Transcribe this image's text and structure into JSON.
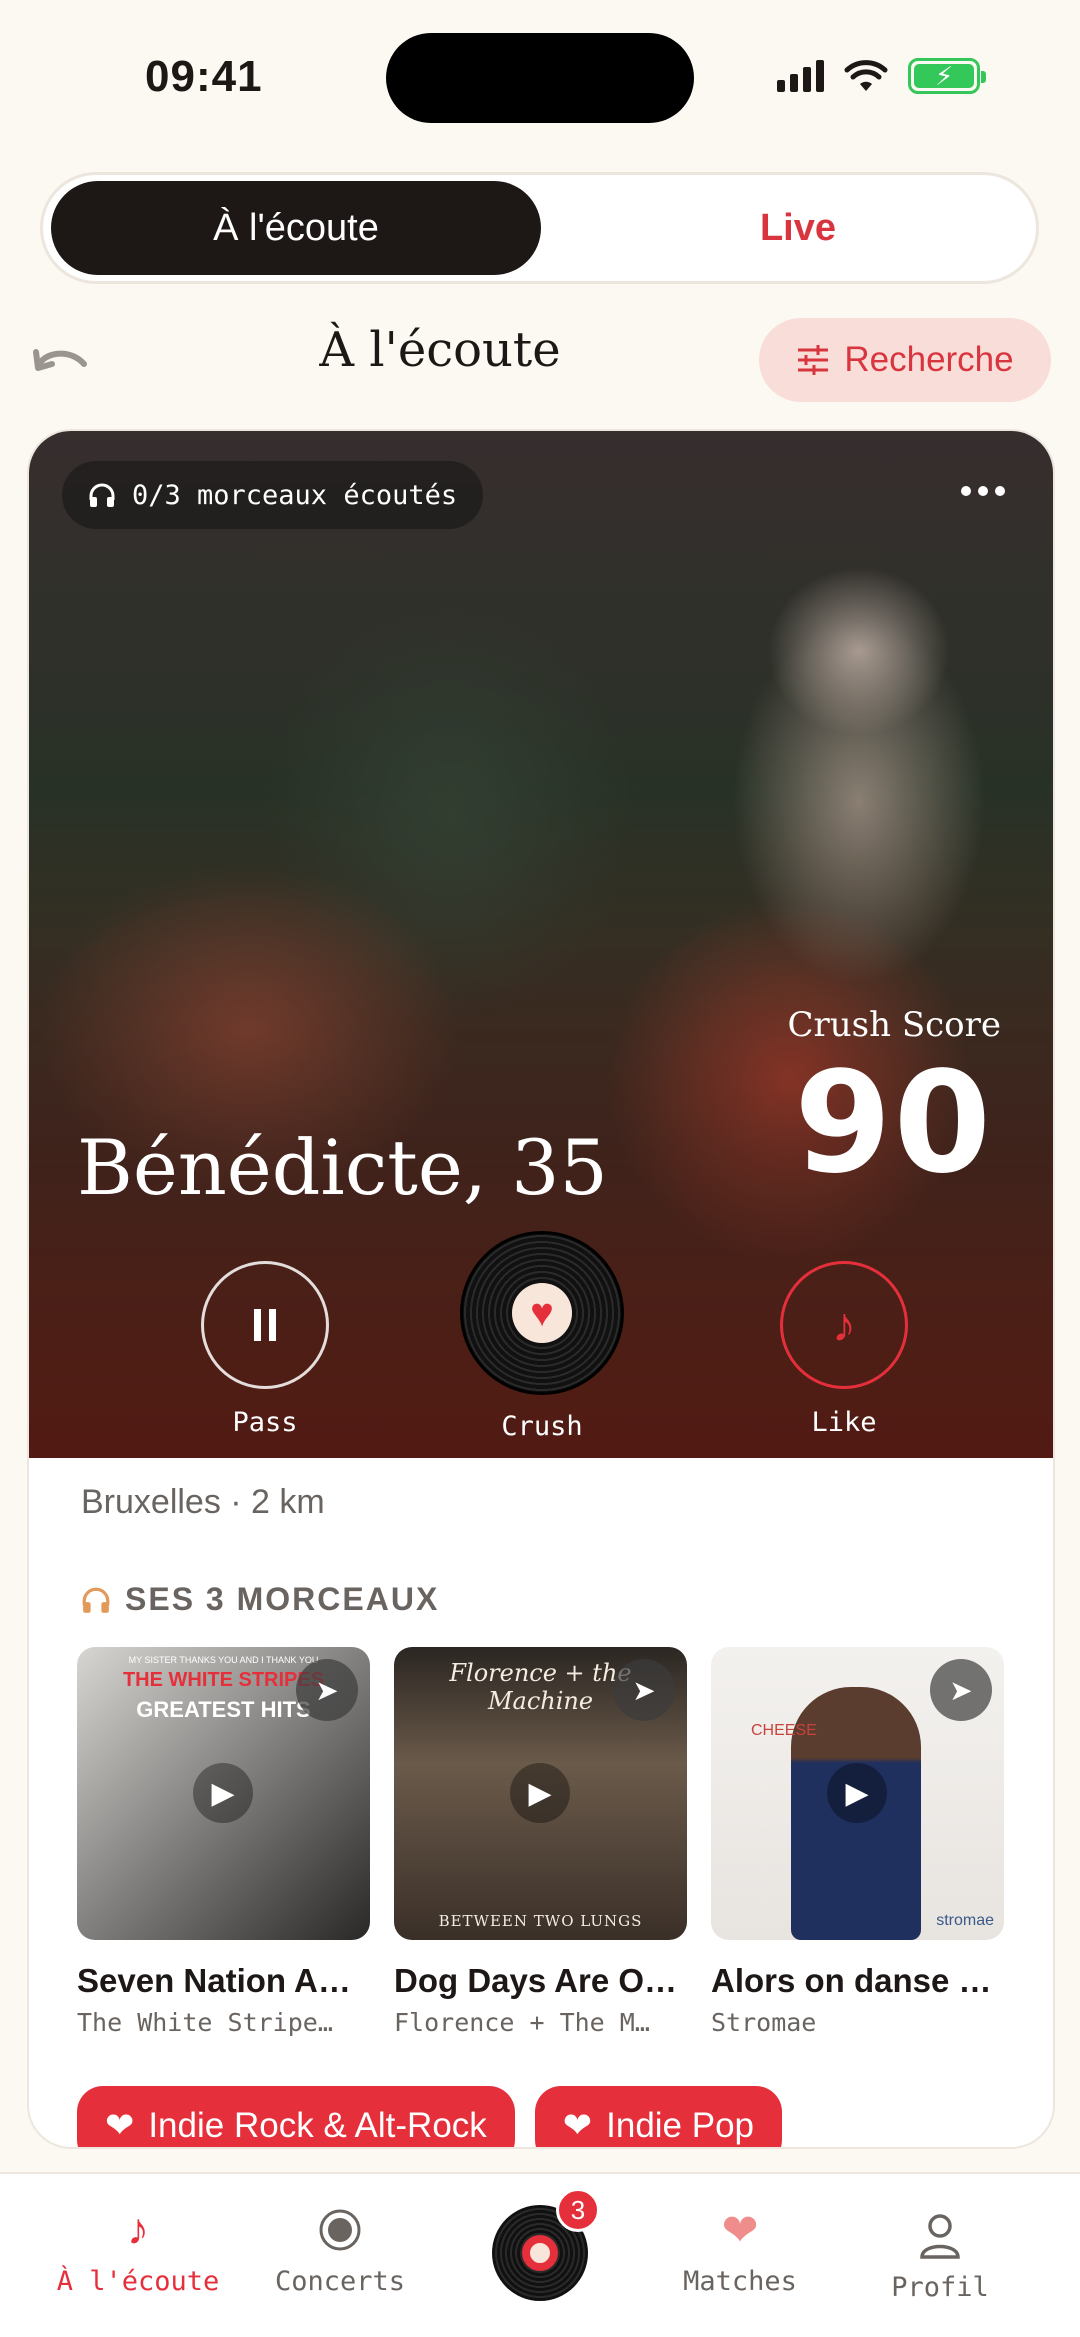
{
  "status_bar": {
    "time": "09:41"
  },
  "tabs": {
    "active": "À l'écoute",
    "inactive": "Live"
  },
  "header": {
    "title": "À l'écoute",
    "search_label": "Recherche"
  },
  "profile": {
    "listened_counter": "0/3 morceaux écoutés",
    "name_age": "Bénédicte, 35",
    "crush_score_label": "Crush Score",
    "crush_score": "90",
    "location": "Bruxelles · 2 km",
    "actions": {
      "pass": "Pass",
      "crush": "Crush",
      "like": "Like"
    }
  },
  "tracks_section": {
    "title": "SES 3 MORCEAUX",
    "tracks": [
      {
        "title": "Seven Nation A…",
        "artist": "The White Stripe…",
        "cover_text": [
          "MY SISTER THANKS YOU AND I THANK YOU",
          "THE WHITE STRIPES",
          "GREATEST HITS"
        ]
      },
      {
        "title": "Dog Days Are O…",
        "artist": "Florence + The M…",
        "cover_text": [
          "Florence + the Machine",
          "BETWEEN TWO LUNGS"
        ]
      },
      {
        "title": "Alors on danse …",
        "artist": "Stromae",
        "cover_text": [
          "CHEESE",
          "stromae"
        ]
      }
    ]
  },
  "tags": [
    "Indie Rock & Alt-Rock",
    "Indie Pop"
  ],
  "bottom_nav": {
    "listen": "À l'écoute",
    "concerts": "Concerts",
    "matches": "Matches",
    "profile": "Profil",
    "center_badge": "3"
  },
  "colors": {
    "accent": "#e5303c",
    "background": "#fcf8f2",
    "dark": "#1d1716"
  }
}
